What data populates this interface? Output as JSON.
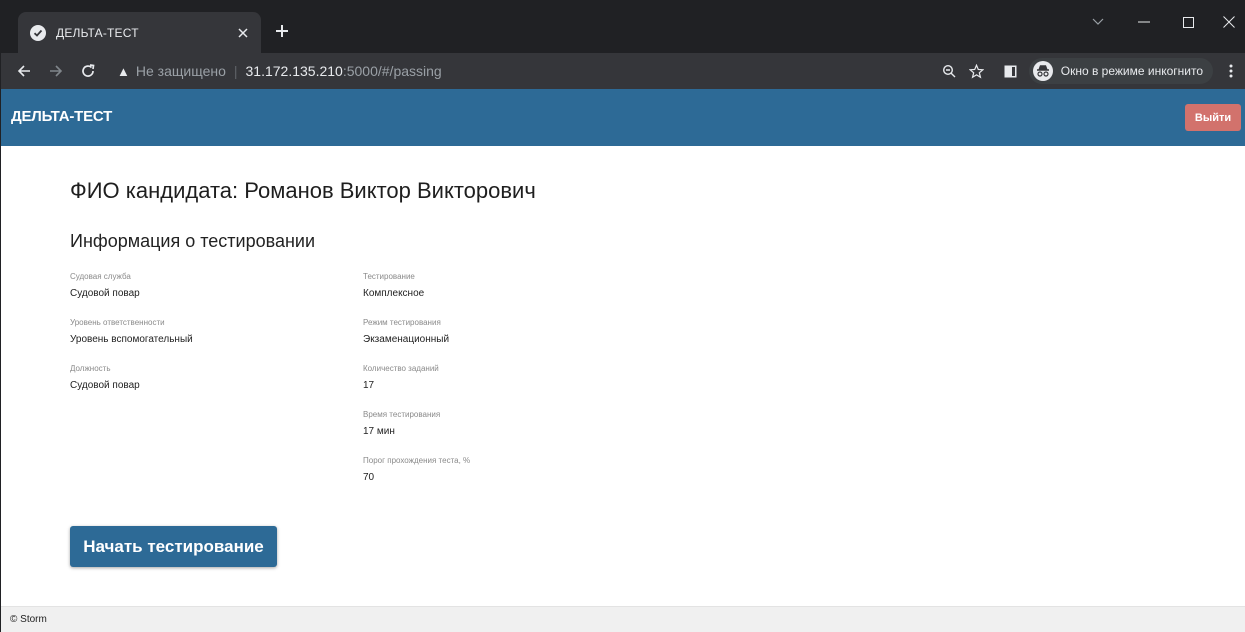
{
  "browser": {
    "tab_title": "ДЕЛЬТА-ТЕСТ",
    "address_not_secure": "Не защищено",
    "address_host": "31.172.135.210",
    "address_path": ":5000/#/passing",
    "incognito_label": "Окно в режиме инкогнито",
    "icons": [
      "check-favicon-icon",
      "close-icon",
      "plus-icon",
      "back-icon",
      "forward-icon",
      "reload-icon",
      "warning-icon",
      "zoom-icon",
      "star-icon",
      "sidepanel-icon",
      "incognito-icon",
      "menu-icon",
      "minimize-icon",
      "maximize-icon",
      "window-close-icon",
      "tab-search-icon"
    ]
  },
  "header": {
    "brand": "ДЕЛЬТА-ТЕСТ",
    "logout_label": "Выйти",
    "bg_color": "#2d6a96",
    "logout_color": "#d2726c"
  },
  "main": {
    "candidate_title": "ФИО кандидата: Романов Виктор Викторович",
    "section_title": "Информация о тестировании",
    "left_fields": [
      {
        "label": "Судовая служба",
        "value": "Судовой повар"
      },
      {
        "label": "Уровень ответственности",
        "value": "Уровень вспомогательный"
      },
      {
        "label": "Должность",
        "value": "Судовой повар"
      }
    ],
    "right_fields": [
      {
        "label": "Тестирование",
        "value": "Комплексное"
      },
      {
        "label": "Режим тестирования",
        "value": "Экзаменационный"
      },
      {
        "label": "Количество заданий",
        "value": "17"
      },
      {
        "label": "Время тестирования",
        "value": "17 мин"
      },
      {
        "label": "Порог прохождения теста, %",
        "value": "70"
      }
    ],
    "start_button_label": "Начать тестирование"
  },
  "footer": {
    "text": "© Storm"
  }
}
